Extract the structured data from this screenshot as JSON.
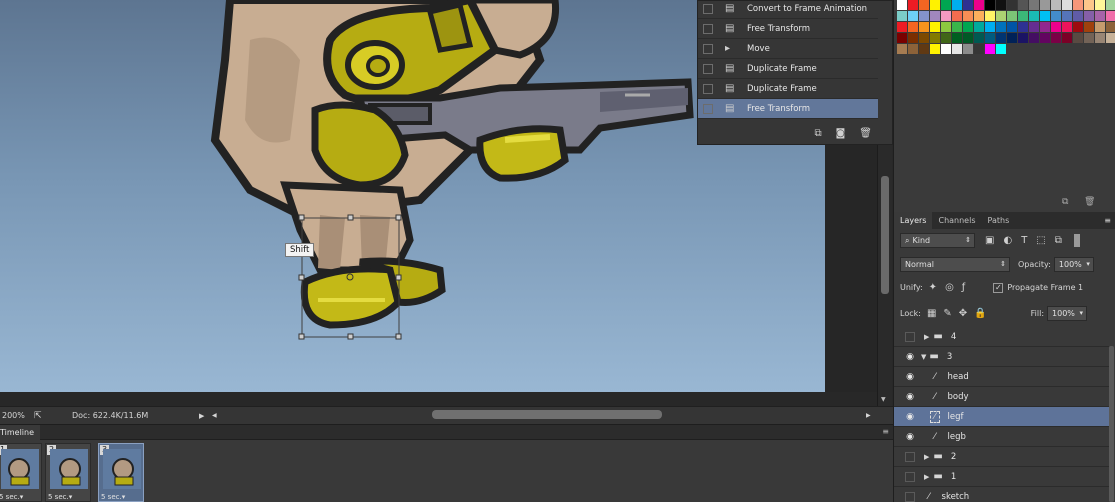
{
  "canvas": {
    "tooltip": "Shift"
  },
  "statusbar": {
    "zoom": "200%",
    "doc": "Doc: 622.4K/11.6M"
  },
  "timeline": {
    "tab": "Timeline",
    "frames": [
      {
        "num": "1",
        "duration": "5 sec.▾"
      },
      {
        "num": "2",
        "duration": "5 sec.▾"
      },
      {
        "num": "3",
        "duration": "5 sec.▾"
      }
    ]
  },
  "history": {
    "items": [
      {
        "label": "Convert to Frame Animation"
      },
      {
        "label": "Free Transform"
      },
      {
        "label": "Move"
      },
      {
        "label": "Duplicate Frame"
      },
      {
        "label": "Duplicate Frame"
      },
      {
        "label": "Free Transform"
      }
    ]
  },
  "swatches": {
    "colors": [
      "#ffffff",
      "#ed1c24",
      "#f26522",
      "#fff200",
      "#00a651",
      "#00aeef",
      "#2e3192",
      "#ec008c",
      "#000000",
      "#111111",
      "#333333",
      "#555555",
      "#777777",
      "#999999",
      "#bbbbbb",
      "#dddddd",
      "#f7977a",
      "#fdc68a",
      "#fff79a",
      "#a2d39c",
      "#7bcdc8",
      "#6dcff6",
      "#8393ca",
      "#a187be",
      "#f49ac1",
      "#f26c4f",
      "#f68e55",
      "#fbaf5c",
      "#fff467",
      "#acd372",
      "#7cc576",
      "#3bb878",
      "#1abbb4",
      "#00bff3",
      "#438cca",
      "#5574b9",
      "#605ca8",
      "#855fa8",
      "#a763a8",
      "#f06eaa",
      "#ed1c24",
      "#f26522",
      "#f7941d",
      "#fff200",
      "#8dc73f",
      "#39b54a",
      "#00a651",
      "#00a99d",
      "#00aeef",
      "#0072bc",
      "#0054a6",
      "#2e3192",
      "#662d91",
      "#92278f",
      "#ec008c",
      "#ed145b",
      "#9e0b0f",
      "#a0410d",
      "#c69c6d",
      "#8c6239",
      "#790000",
      "#7b2e00",
      "#7d4900",
      "#827b00",
      "#406618",
      "#005e20",
      "#005826",
      "#005952",
      "#005b7f",
      "#003471",
      "#002157",
      "#1b1464",
      "#440e62",
      "#630460",
      "#7b0046",
      "#7a0026",
      "#594a42",
      "#736357",
      "#998675",
      "#c7b299",
      "#a67c52",
      "#8c6239",
      "#603913",
      "#fff200",
      "#ffffff",
      "#e6e6e6",
      "#8c8c8c",
      "#363636",
      "#ff00ff",
      "#00ffff"
    ]
  },
  "layers": {
    "tabs": [
      "Layers",
      "Channels",
      "Paths"
    ],
    "filter": "Kind",
    "blend": "Normal",
    "opacity_label": "Opacity:",
    "opacity": "100%",
    "unify_label": "Unify:",
    "propagate": "Propagate Frame 1",
    "lock_label": "Lock:",
    "fill_label": "Fill:",
    "fill": "100%",
    "items": [
      {
        "name": "4",
        "visible": false,
        "type": "group",
        "expanded": false,
        "indent": 0
      },
      {
        "name": "3",
        "visible": true,
        "type": "group",
        "expanded": true,
        "indent": 0
      },
      {
        "name": "head",
        "visible": true,
        "type": "layer",
        "indent": 1
      },
      {
        "name": "body",
        "visible": true,
        "type": "layer",
        "indent": 1
      },
      {
        "name": "legf",
        "visible": true,
        "type": "layer",
        "indent": 1,
        "selected": true
      },
      {
        "name": "legb",
        "visible": true,
        "type": "layer",
        "indent": 1
      },
      {
        "name": "2",
        "visible": false,
        "type": "group",
        "expanded": false,
        "indent": 0
      },
      {
        "name": "1",
        "visible": false,
        "type": "group",
        "expanded": false,
        "indent": 0
      },
      {
        "name": "sketch",
        "visible": false,
        "type": "layer",
        "indent": 0
      }
    ]
  }
}
